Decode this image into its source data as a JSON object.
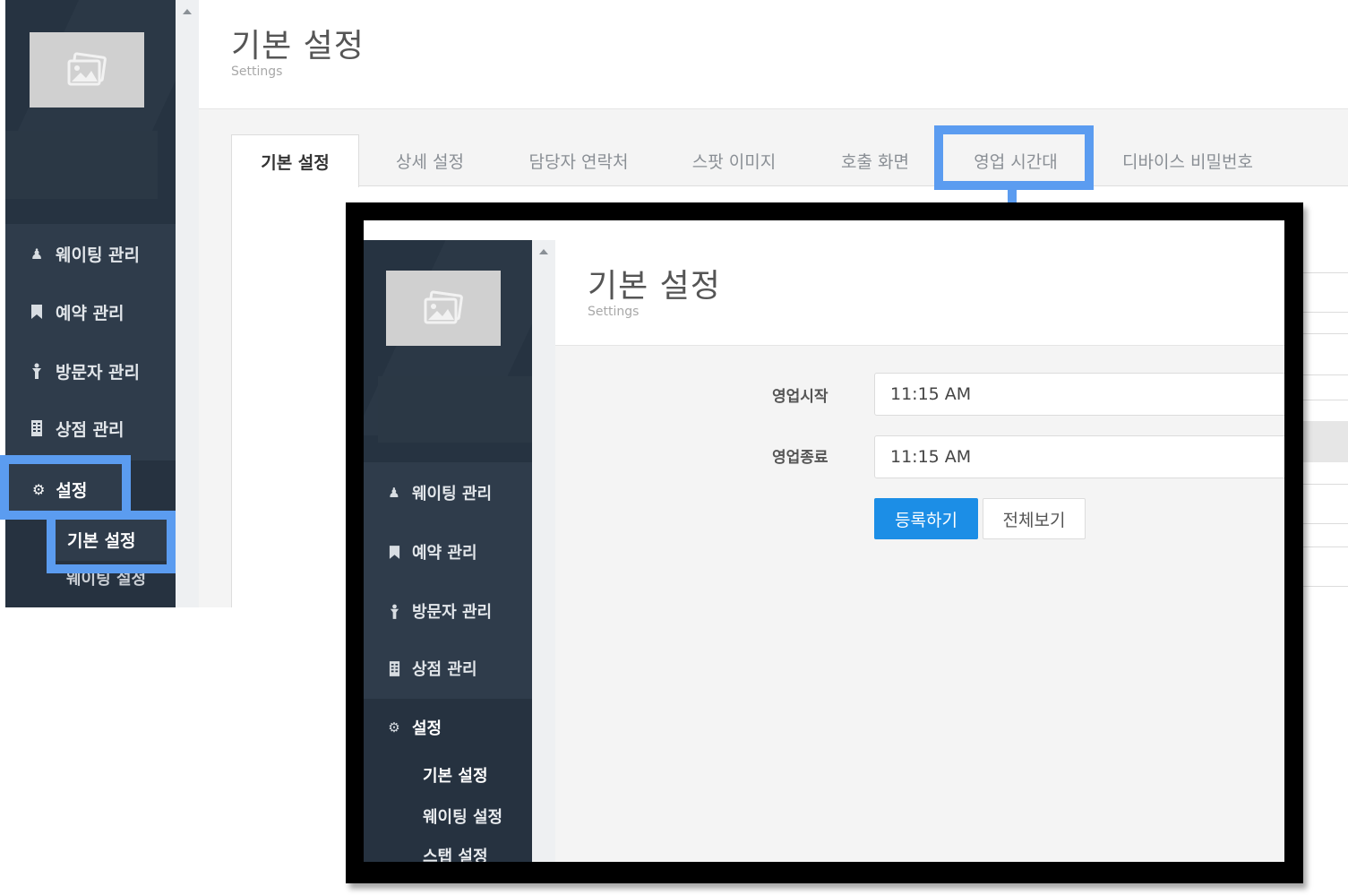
{
  "background": {
    "page_title": "기본 설정",
    "page_subtitle": "Settings",
    "sidebar": {
      "items": [
        {
          "label": "웨이팅 관리",
          "icon": "user-add-icon"
        },
        {
          "label": "예약 관리",
          "icon": "bookmark-icon"
        },
        {
          "label": "방문자 관리",
          "icon": "person-icon"
        },
        {
          "label": "상점 관리",
          "icon": "building-icon"
        },
        {
          "label": "설정",
          "icon": "gear-icon"
        }
      ],
      "submenu": [
        "기본 설정",
        "웨이팅 설정"
      ]
    },
    "tabs": [
      {
        "label": "기본 설정",
        "active": true
      },
      {
        "label": "상세 설정",
        "active": false
      },
      {
        "label": "담당자 연락처",
        "active": false
      },
      {
        "label": "스팟 이미지",
        "active": false
      },
      {
        "label": "호출 화면",
        "active": false
      },
      {
        "label": "영업 시간대",
        "active": false,
        "highlighted": true
      },
      {
        "label": "디바이스 비밀번호",
        "active": false
      }
    ]
  },
  "inset": {
    "page_title": "기본 설정",
    "page_subtitle": "Settings",
    "sidebar": {
      "items": [
        {
          "label": "웨이팅 관리",
          "icon": "user-add-icon"
        },
        {
          "label": "예약 관리",
          "icon": "bookmark-icon"
        },
        {
          "label": "방문자 관리",
          "icon": "person-icon"
        },
        {
          "label": "상점 관리",
          "icon": "building-icon"
        },
        {
          "label": "설정",
          "icon": "gear-icon"
        }
      ],
      "submenu": [
        "기본 설정",
        "웨이팅 설정",
        "스탭 설정"
      ]
    },
    "form": {
      "open_label": "영업시작",
      "open_value": "11:15 AM",
      "close_label": "영업종료",
      "close_value": "11:15 AM",
      "submit_label": "등록하기",
      "view_all_label": "전체보기"
    }
  },
  "colors": {
    "highlight": "#5b9cf0",
    "sidebar": "#2f3c4b",
    "primary_button": "#1c8ee6"
  }
}
